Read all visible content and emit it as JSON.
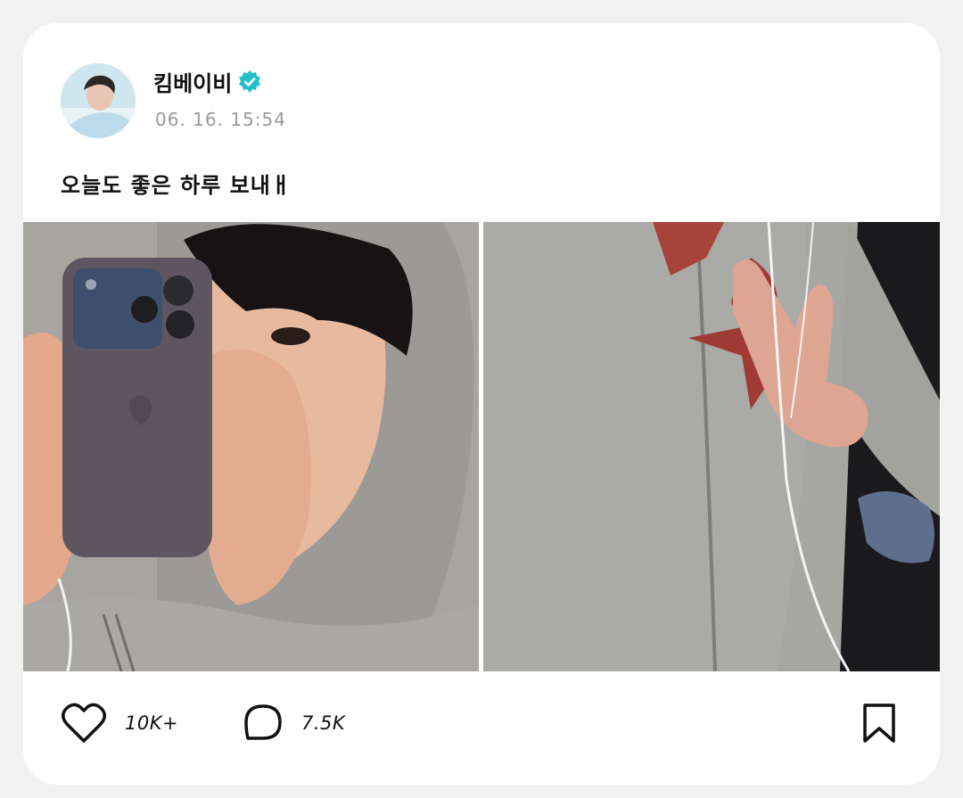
{
  "post": {
    "username": "킴베이비",
    "timestamp": "06. 16. 15:54",
    "caption": "오늘도 좋은 하루 보내ㅐ",
    "verified_color": "#22bfc9"
  },
  "photos": [
    {
      "label": "mirror selfie holding phone in grey hoodie"
    },
    {
      "label": "grey zip hoodie with red star, peace sign"
    }
  ],
  "actions": {
    "likes": "10K+",
    "comments": "7.5K"
  },
  "icons": [
    "verified-badge-icon",
    "heart-icon",
    "comment-icon",
    "bookmark-icon"
  ]
}
